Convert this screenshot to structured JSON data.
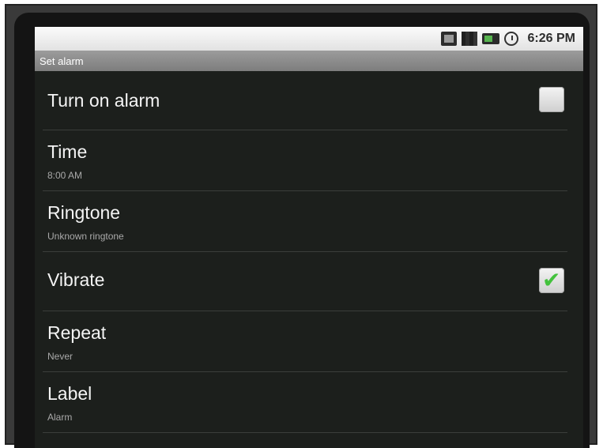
{
  "status_bar": {
    "time": "6:26 PM"
  },
  "title_bar": {
    "title": "Set alarm"
  },
  "settings": [
    {
      "label": "Turn on alarm",
      "checked": false
    },
    {
      "label": "Time",
      "value": "8:00 AM"
    },
    {
      "label": "Ringtone",
      "value": "Unknown ringtone"
    },
    {
      "label": "Vibrate",
      "checked": true
    },
    {
      "label": "Repeat",
      "value": "Never"
    },
    {
      "label": "Label",
      "value": "Alarm"
    }
  ],
  "colors": {
    "accent_check": "#43c23d",
    "background": "#1c1f1c"
  }
}
